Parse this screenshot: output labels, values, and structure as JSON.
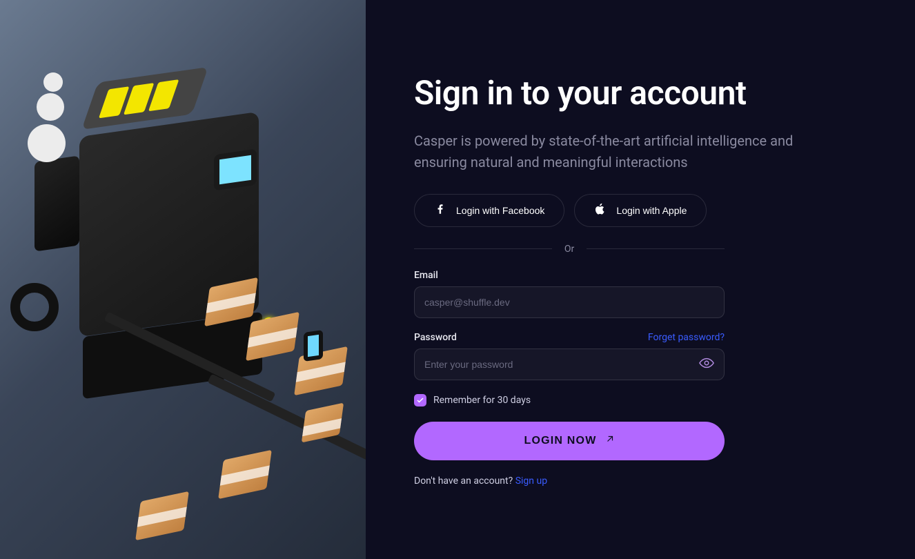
{
  "page": {
    "title": "Sign in to your account",
    "subtitle": "Casper is powered by state-of-the-art artificial intelligence and ensuring natural and meaningful interactions"
  },
  "social": {
    "facebook_label": "Login with Facebook",
    "apple_label": "Login with Apple"
  },
  "divider_label": "Or",
  "form": {
    "email": {
      "label": "Email",
      "placeholder": "casper@shuffle.dev",
      "value": ""
    },
    "password": {
      "label": "Password",
      "placeholder": "Enter your password",
      "value": "",
      "forgot_label": "Forget password?"
    },
    "remember": {
      "label": "Remember for 30 days",
      "checked": true
    },
    "submit_label": "LOGIN NOW"
  },
  "signup": {
    "prompt": "Don't have an account? ",
    "link_label": "Sign up"
  },
  "colors": {
    "bg": "#0d0d20",
    "accent": "#b268ff",
    "link": "#3a5cff",
    "muted": "#8a8aa0"
  }
}
